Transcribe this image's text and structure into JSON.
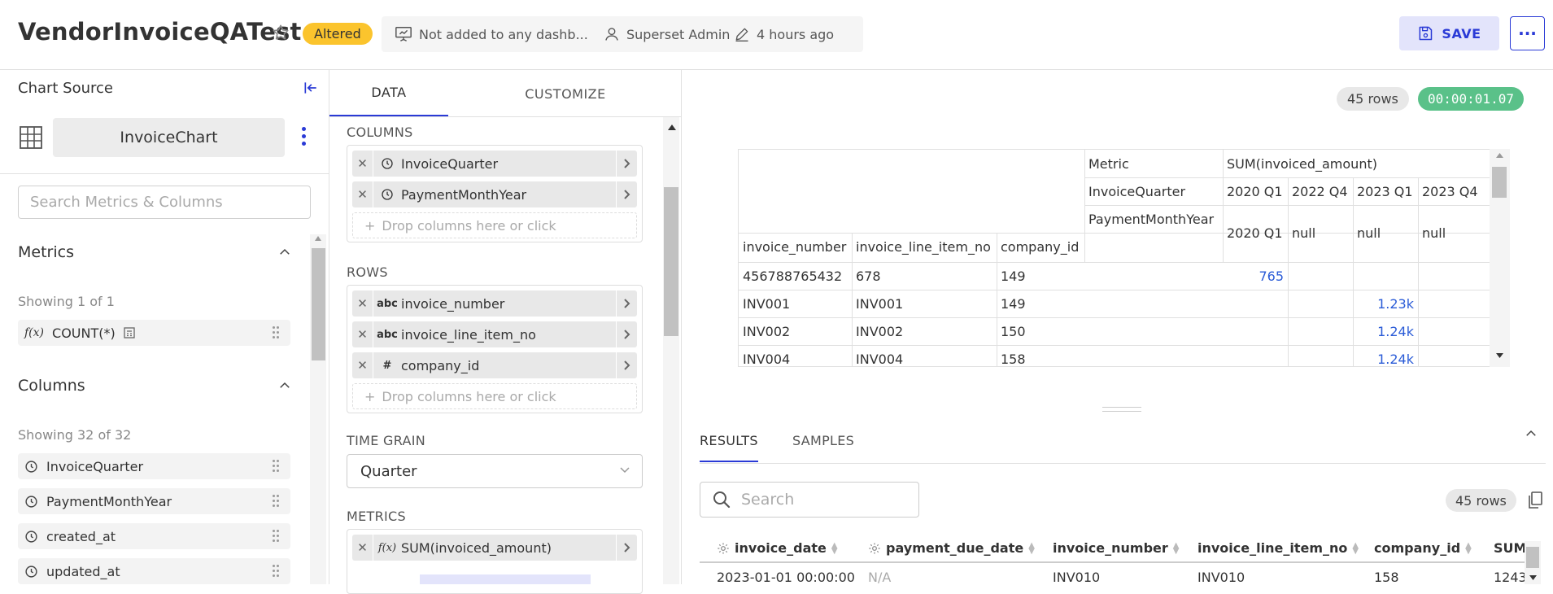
{
  "header": {
    "title": "VendorInvoiceQATest",
    "status_badge": "Altered",
    "dashboards": "Not added to any dashb...",
    "owner": "Superset Admin",
    "modified": "4 hours ago",
    "save_label": "SAVE",
    "more_label": "···"
  },
  "left_panel": {
    "chart_source_label": "Chart Source",
    "dataset_name": "InvoiceChart",
    "search_placeholder": "Search Metrics & Columns",
    "metrics": {
      "title": "Metrics",
      "showing": "Showing 1 of 1",
      "items": [
        {
          "label": "COUNT(*)",
          "icon": "function-icon"
        }
      ]
    },
    "columns": {
      "title": "Columns",
      "showing": "Showing 32 of 32",
      "items": [
        {
          "label": "InvoiceQuarter",
          "icon": "clock-icon"
        },
        {
          "label": "PaymentMonthYear",
          "icon": "clock-icon"
        },
        {
          "label": "created_at",
          "icon": "clock-icon"
        },
        {
          "label": "updated_at",
          "icon": "clock-icon"
        }
      ]
    }
  },
  "middle_panel": {
    "tabs": [
      {
        "label": "DATA"
      },
      {
        "label": "CUSTOMIZE"
      }
    ],
    "columns_section": {
      "label": "COLUMNS",
      "items": [
        {
          "label": "InvoiceQuarter",
          "type_icon": "clock-icon"
        },
        {
          "label": "PaymentMonthYear",
          "type_icon": "clock-icon"
        }
      ],
      "drop_hint": "Drop columns here or click"
    },
    "rows_section": {
      "label": "ROWS",
      "items": [
        {
          "label": "invoice_number",
          "type_text": "abc"
        },
        {
          "label": "invoice_line_item_no",
          "type_text": "abc"
        },
        {
          "label": "company_id",
          "type_text": "#"
        }
      ],
      "drop_hint": "Drop columns here or click"
    },
    "time_grain": {
      "label": "TIME GRAIN",
      "value": "Quarter"
    },
    "metrics_section": {
      "label": "METRICS",
      "items": [
        {
          "label": "SUM(invoiced_amount)",
          "type_text": "f(x)"
        }
      ]
    }
  },
  "chart_area": {
    "row_count": "45 rows",
    "query_time": "00:00:01.07",
    "pivot": {
      "header_labels": {
        "metric": "Metric",
        "col1": "InvoiceQuarter",
        "col2": "PaymentMonthYear"
      },
      "metric_name": "SUM(invoiced_amount)",
      "quarters": [
        "2020 Q1",
        "2022 Q4",
        "2023 Q1",
        "2023 Q4"
      ],
      "payment_months": [
        "2020 Q1",
        "null",
        "null",
        "null"
      ],
      "row_headers": [
        "invoice_number",
        "invoice_line_item_no",
        "company_id"
      ],
      "rows": [
        {
          "invoice_number": "456788765432",
          "line_item": "678",
          "company_id": "149",
          "values": [
            "765",
            "",
            "",
            ""
          ]
        },
        {
          "invoice_number": "INV001",
          "line_item": "INV001",
          "company_id": "149",
          "values": [
            "",
            "",
            "1.23k",
            ""
          ]
        },
        {
          "invoice_number": "INV002",
          "line_item": "INV002",
          "company_id": "150",
          "values": [
            "",
            "",
            "1.24k",
            ""
          ]
        },
        {
          "invoice_number": "INV004",
          "line_item": "INV004",
          "company_id": "158",
          "values": [
            "",
            "",
            "1.24k",
            ""
          ]
        }
      ]
    }
  },
  "results": {
    "tabs": [
      {
        "label": "RESULTS"
      },
      {
        "label": "SAMPLES"
      }
    ],
    "search_placeholder": "Search",
    "row_count": "45 rows",
    "columns": [
      "invoice_date",
      "payment_due_date",
      "invoice_number",
      "invoice_line_item_no",
      "company_id",
      "SUM"
    ],
    "first_row": [
      "2023-01-01 00:00:00",
      "N/A",
      "INV010",
      "INV010",
      "158",
      "1243"
    ]
  },
  "colors": {
    "accent": "#2a3ad6",
    "altered_badge": "#fbc42d",
    "timer_badge": "#5ac189",
    "pivot_number": "#2a5bd7"
  }
}
